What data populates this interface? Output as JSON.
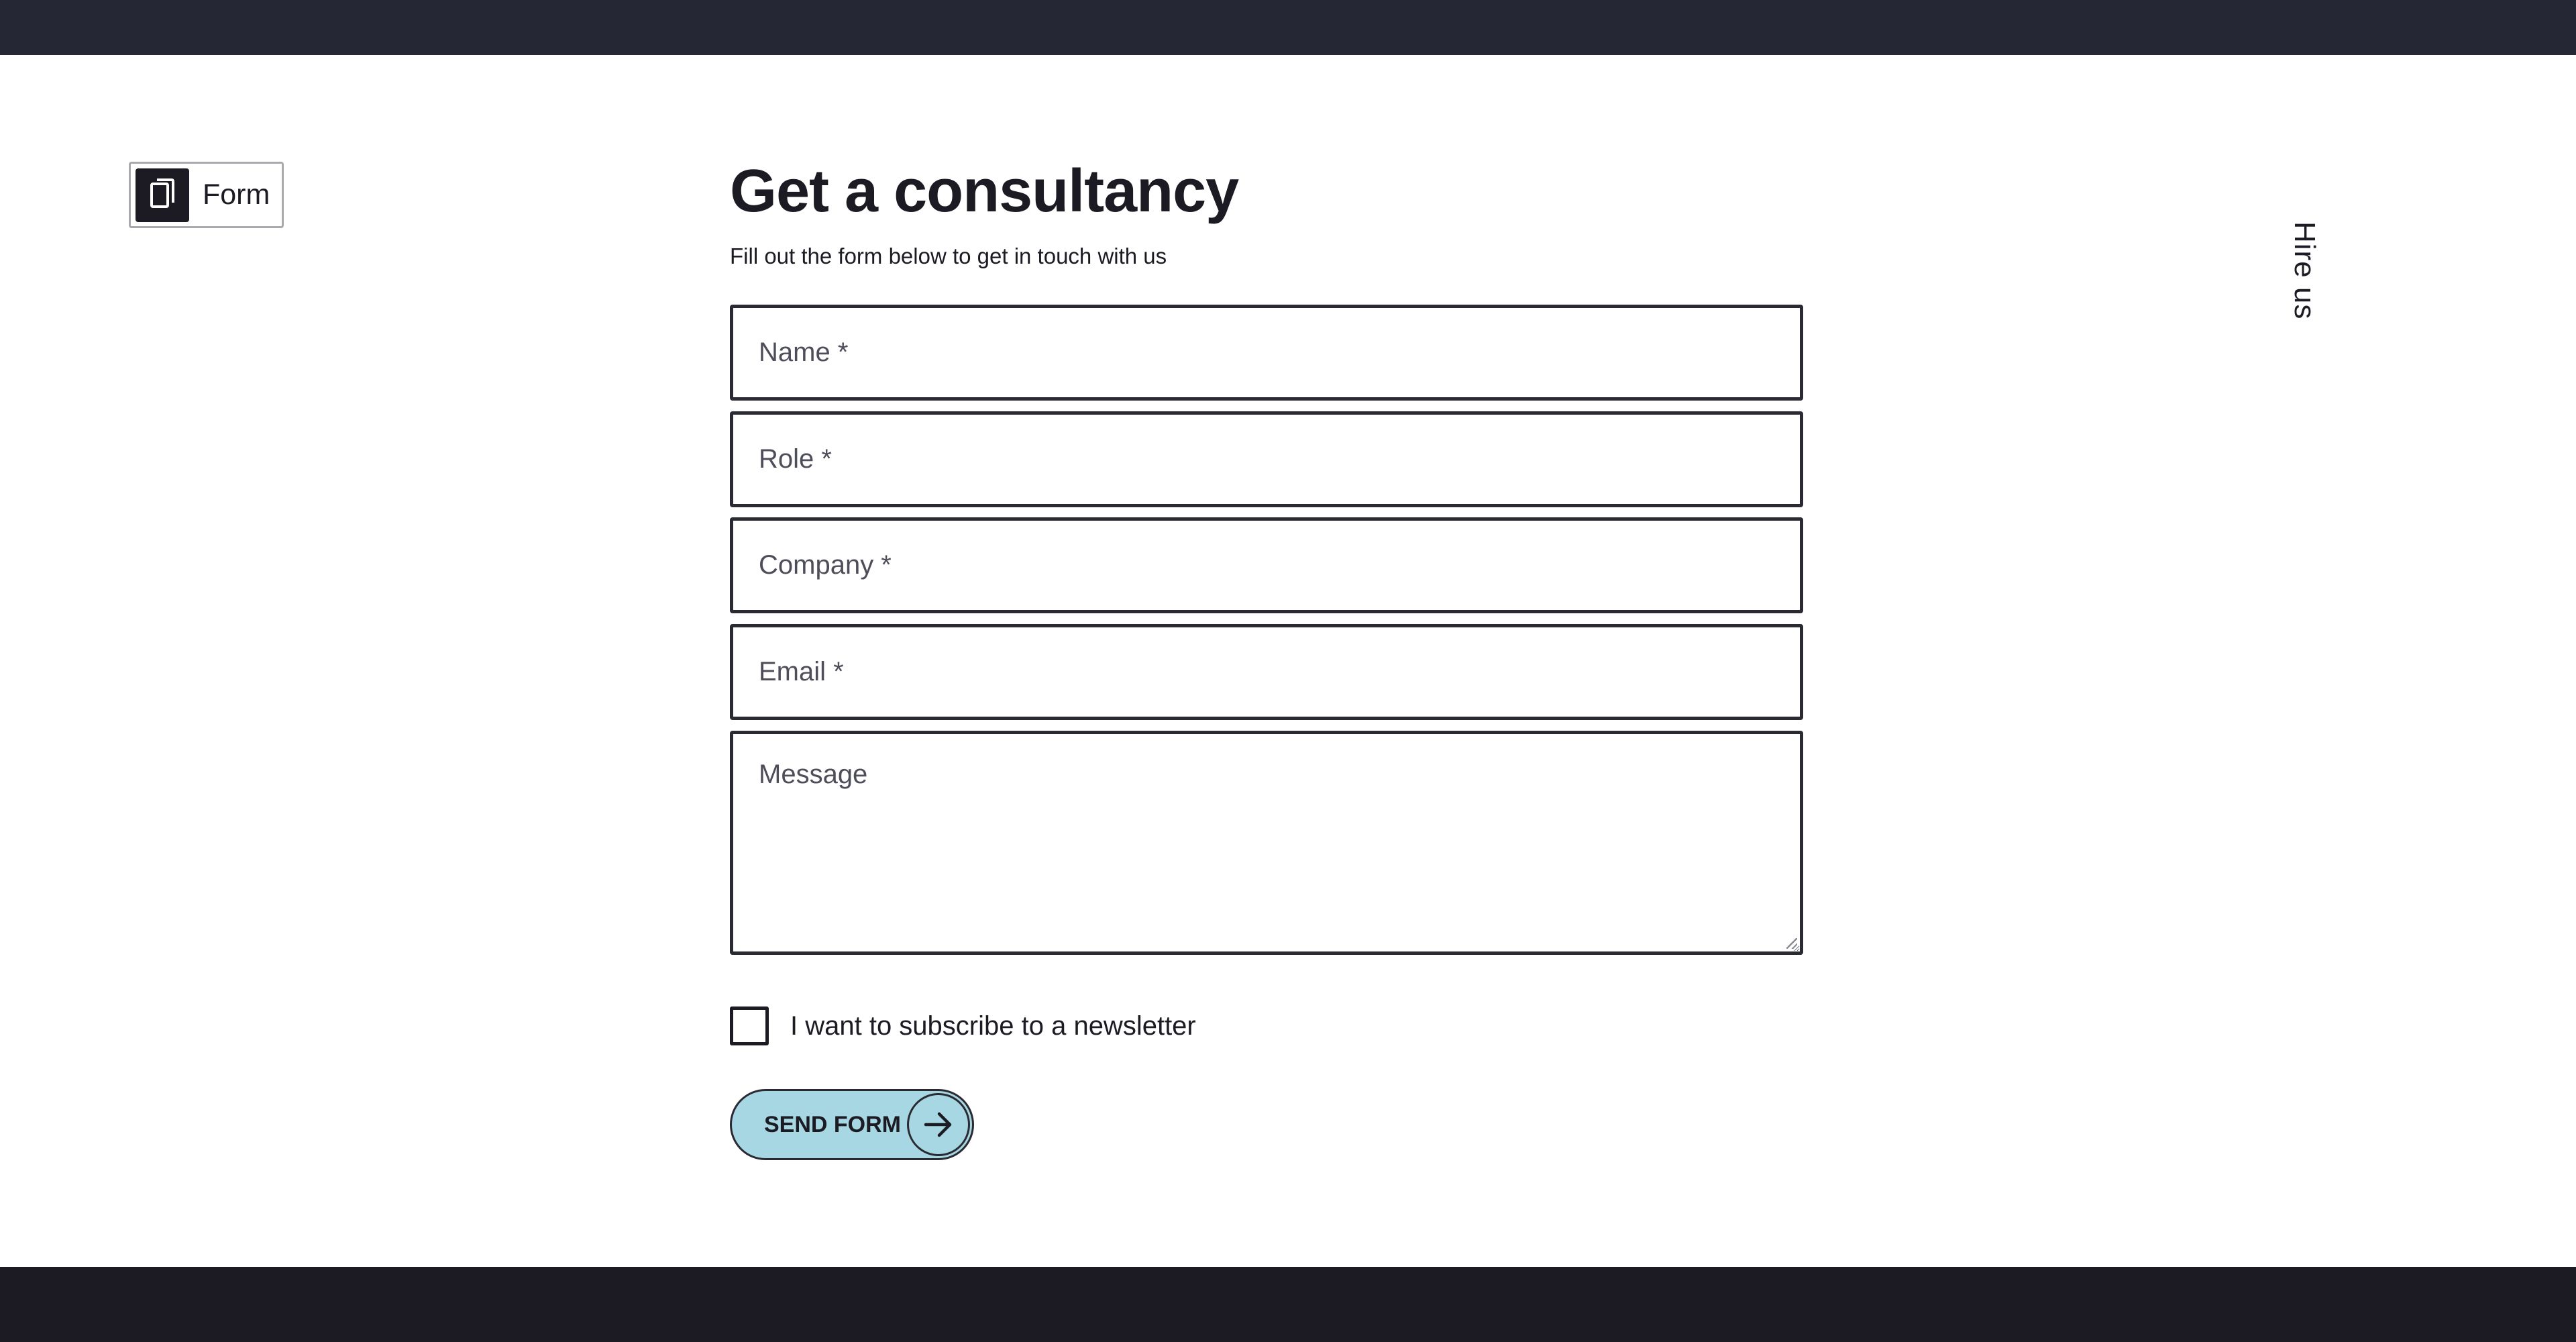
{
  "tag": {
    "label": "Form",
    "icon": "document-copy-icon"
  },
  "side": {
    "label": "Hire us"
  },
  "form": {
    "title": "Get a consultancy",
    "subtitle": "Fill out the form below to get in touch with us",
    "fields": {
      "name": {
        "placeholder": "Name *",
        "value": ""
      },
      "role": {
        "placeholder": "Role *",
        "value": ""
      },
      "company": {
        "placeholder": "Company *",
        "value": ""
      },
      "email": {
        "placeholder": "Email *",
        "value": ""
      },
      "message": {
        "placeholder": "Message",
        "value": ""
      }
    },
    "newsletter": {
      "label": "I want to subscribe to a newsletter",
      "checked": false
    },
    "submit": {
      "label": "SEND FORM",
      "icon": "arrow-right-icon"
    }
  },
  "colors": {
    "top_bar": "#252735",
    "bottom_bar": "#1c1a22",
    "button_bg": "#a8d7e4",
    "text": "#1c1a22"
  }
}
